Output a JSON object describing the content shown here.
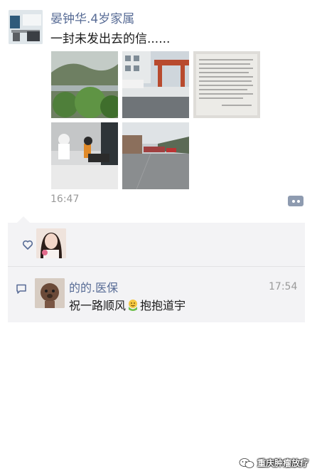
{
  "post": {
    "author": "晏钟华.4岁家属",
    "text": "一封未发出去的信......",
    "time": "16:47",
    "photos": [
      {
        "icon": "photo-mountain-trees"
      },
      {
        "icon": "photo-building-gate"
      },
      {
        "icon": "photo-handwritten-letter"
      },
      {
        "icon": "photo-hospital-room"
      },
      {
        "icon": "photo-street"
      }
    ],
    "more_icon": "more-dots-icon"
  },
  "likes": {
    "icon": "heart-icon"
  },
  "comments": [
    {
      "author": "的的.医保",
      "time": "17:54",
      "text_before": "祝一路顺风",
      "emoji": "hug-emoji",
      "text_after": "抱抱道宇"
    }
  ],
  "watermark": {
    "text": "重庆肿瘤放疗"
  },
  "colors": {
    "name_link": "#576b95",
    "comment_bg": "#f3f3f5",
    "time_gray": "#9a9a9a"
  }
}
